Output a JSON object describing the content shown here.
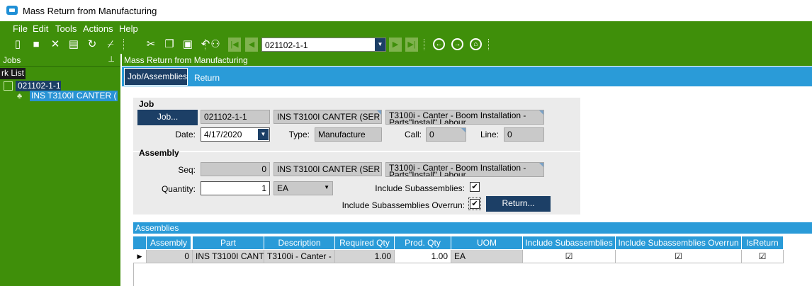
{
  "window": {
    "title": "Mass Return from Manufacturing"
  },
  "menu": {
    "items": [
      "File",
      "Edit",
      "Tools",
      "Actions",
      "Help"
    ]
  },
  "toolbar": {
    "icons": [
      "new-icon",
      "save-icon",
      "delete-icon",
      "attach-icon",
      "refresh-icon",
      "clear-icon",
      "cut-icon",
      "copy-icon",
      "paste-icon",
      "undo-icon",
      "binoculars-icon",
      "first-icon",
      "prev-icon",
      "next-icon",
      "last-icon",
      "back-icon",
      "forward-icon",
      "home-icon"
    ],
    "job_value": "021102-1-1"
  },
  "left_pane": {
    "title": "Jobs",
    "worklist_label": "rk List",
    "tree": [
      {
        "label": "021102-1-1"
      },
      {
        "label": "INS T3100I CANTER ("
      }
    ]
  },
  "right_pane": {
    "title": "Mass Return from Manufacturing",
    "tabs": [
      "Job/Assemblies",
      "Return"
    ]
  },
  "job": {
    "section_label": "Job",
    "job_button": "Job...",
    "job_num": "021102-1-1",
    "part": "INS T3100I CANTER (SER",
    "description": "T3100i - Canter - Boom Installation - Parts\"Install\" Labour",
    "date_label": "Date:",
    "date_value": "4/17/2020",
    "type_label": "Type:",
    "type_value": "Manufacture",
    "call_label": "Call:",
    "call_value": "0",
    "line_label": "Line:",
    "line_value": "0"
  },
  "assembly": {
    "section_label": "Assembly",
    "seq_label": "Seq:",
    "seq_value": "0",
    "part": "INS T3100I CANTER (SER",
    "description": "T3100i - Canter - Boom Installation - Parts\"Install\" Labour",
    "qty_label": "Quantity:",
    "qty_value": "1",
    "uom_value": "EA",
    "include_sub_label": "Include Subassemblies:",
    "include_sub_checked": true,
    "include_sub_overrun_label": "Include Subassemblies Overrun:",
    "include_sub_overrun_checked": true,
    "return_button": "Return..."
  },
  "assemblies_grid": {
    "title": "Assemblies",
    "columns": [
      "Assembly",
      "Part",
      "Description",
      "Required Qty",
      "Prod. Qty",
      "UOM",
      "Include Subassemblies",
      "Include Subassemblies Overrun",
      "IsReturn"
    ],
    "rows": [
      {
        "assembly": "0",
        "part": "INS T3100I CANT",
        "description": "T3100i - Canter -",
        "required_qty": "1.00",
        "prod_qty": "1.00",
        "uom": "EA",
        "include_sub": true,
        "include_sub_overrun": true,
        "is_return": true
      }
    ]
  },
  "colors": {
    "header_green": "#3f8f0a",
    "accent_blue": "#2a9bd8",
    "navy": "#1c3f66"
  }
}
